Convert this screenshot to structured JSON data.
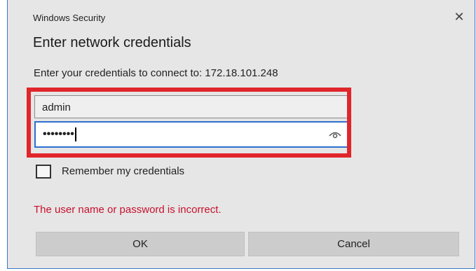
{
  "window": {
    "title": "Windows Security",
    "close_glyph": "✕"
  },
  "dialog": {
    "heading": "Enter network credentials",
    "prompt": "Enter your credentials to connect to: 172.18.101.248"
  },
  "form": {
    "username_value": "admin",
    "password_masked": "••••••••",
    "reveal_icon": "eye-icon",
    "remember_label": "Remember my credentials",
    "remember_checked": false
  },
  "status": {
    "error_message": "The user name or password is incorrect."
  },
  "buttons": {
    "ok_label": "OK",
    "cancel_label": "Cancel"
  },
  "colors": {
    "highlight": "#e0262b",
    "error": "#c8102e",
    "focus_border": "#2e6fcf",
    "dialog_bg": "#e6e6e6",
    "button_bg": "#cccccc"
  }
}
